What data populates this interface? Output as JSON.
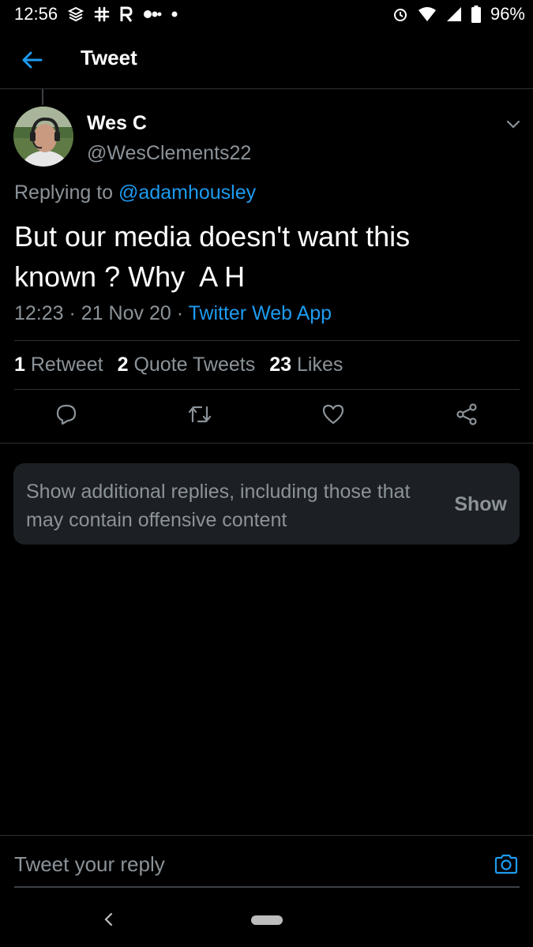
{
  "status_bar": {
    "time": "12:56",
    "left_icons": [
      "vpn-icon",
      "slack-icon",
      "reddit-r-icon",
      "dots-icon",
      "dot-icon"
    ],
    "right_icons": [
      "alarm-icon",
      "wifi-icon",
      "signal-icon",
      "battery-icon"
    ],
    "battery": "96%"
  },
  "header": {
    "title": "Tweet",
    "back_icon": "arrow-left-icon"
  },
  "tweet": {
    "author_name": "Wes C",
    "author_handle": "@WesClements22",
    "replying_prefix": "Replying to ",
    "replying_to": "@adamhousley",
    "text": "But our media doesn't want this\nknown ? Why  A H",
    "time": "12:23",
    "date": "21 Nov 20",
    "source": "Twitter Web App",
    "separator": " · "
  },
  "stats": {
    "retweets_count": "1",
    "retweets_label": "Retweet",
    "quotes_count": "2",
    "quotes_label": "Quote Tweets",
    "likes_count": "23",
    "likes_label": "Likes"
  },
  "actions": [
    "reply-icon",
    "retweet-icon",
    "like-icon",
    "share-icon"
  ],
  "show_more": {
    "text": "Show additional replies, including those that may contain offensive content",
    "button": "Show"
  },
  "composer": {
    "placeholder": "Tweet your reply"
  },
  "colors": {
    "background": "#000000",
    "accent": "#1d9bf0",
    "secondary_text": "#8b9399",
    "divider": "#2f3336"
  }
}
